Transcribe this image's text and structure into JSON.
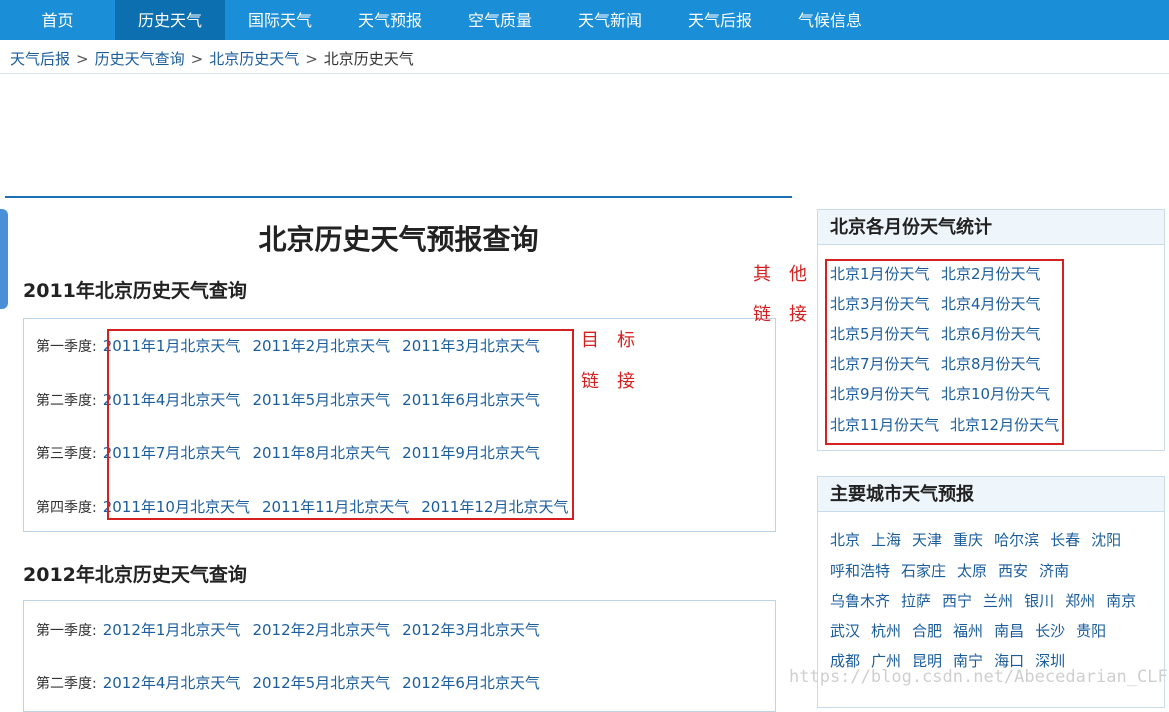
{
  "nav": {
    "items": [
      {
        "label": "首页"
      },
      {
        "label": "历史天气"
      },
      {
        "label": "国际天气"
      },
      {
        "label": "天气预报"
      },
      {
        "label": "空气质量"
      },
      {
        "label": "天气新闻"
      },
      {
        "label": "天气后报"
      },
      {
        "label": "气候信息"
      }
    ],
    "active_index": 1
  },
  "breadcrumb": {
    "items": [
      "天气后报",
      "历史天气查询",
      "北京历史天气",
      "北京历史天气"
    ],
    "separator": ">"
  },
  "main": {
    "title": "北京历史天气预报查询",
    "years": [
      {
        "title": "2011年北京历史天气查询",
        "quarters": [
          {
            "label": "第一季度:",
            "months": [
              "2011年1月北京天气",
              "2011年2月北京天气",
              "2011年3月北京天气"
            ]
          },
          {
            "label": "第二季度:",
            "months": [
              "2011年4月北京天气",
              "2011年5月北京天气",
              "2011年6月北京天气"
            ]
          },
          {
            "label": "第三季度:",
            "months": [
              "2011年7月北京天气",
              "2011年8月北京天气",
              "2011年9月北京天气"
            ]
          },
          {
            "label": "第四季度:",
            "months": [
              "2011年10月北京天气",
              "2011年11月北京天气",
              "2011年12月北京天气"
            ]
          }
        ]
      },
      {
        "title": "2012年北京历史天气查询",
        "quarters": [
          {
            "label": "第一季度:",
            "months": [
              "2012年1月北京天气",
              "2012年2月北京天气",
              "2012年3月北京天气"
            ]
          },
          {
            "label": "第二季度:",
            "months": [
              "2012年4月北京天气",
              "2012年5月北京天气",
              "2012年6月北京天气"
            ]
          }
        ]
      }
    ]
  },
  "annotations": {
    "target_line1": "目标",
    "target_line2": "链接",
    "other_line1": "其他",
    "other_line2": "链接"
  },
  "sidebar": {
    "monthly": {
      "title": "北京各月份天气统计",
      "links": [
        "北京1月份天气",
        "北京2月份天气",
        "北京3月份天气",
        "北京4月份天气",
        "北京5月份天气",
        "北京6月份天气",
        "北京7月份天气",
        "北京8月份天气",
        "北京9月份天气",
        "北京10月份天气",
        "北京11月份天气",
        "北京12月份天气"
      ]
    },
    "cities": {
      "title": "主要城市天气预报",
      "rows": [
        [
          "北京",
          "上海",
          "天津",
          "重庆",
          "哈尔滨",
          "长春",
          "沈阳"
        ],
        [
          "呼和浩特",
          "石家庄",
          "太原",
          "西安",
          "济南"
        ],
        [
          "乌鲁木齐",
          "拉萨",
          "西宁",
          "兰州",
          "银川",
          "郑州",
          "南京"
        ],
        [
          "武汉",
          "杭州",
          "合肥",
          "福州",
          "南昌",
          "长沙",
          "贵阳"
        ],
        [
          "成都",
          "广州",
          "昆明",
          "南宁",
          "海口",
          "深圳"
        ]
      ]
    }
  },
  "watermark": "https://blog.csdn.net/Abecedarian_CLF",
  "colors": {
    "nav_bg": "#1a8ed6",
    "nav_active": "#0c6fb0",
    "link": "#1b5d9c",
    "annotation_red": "#d62020"
  }
}
